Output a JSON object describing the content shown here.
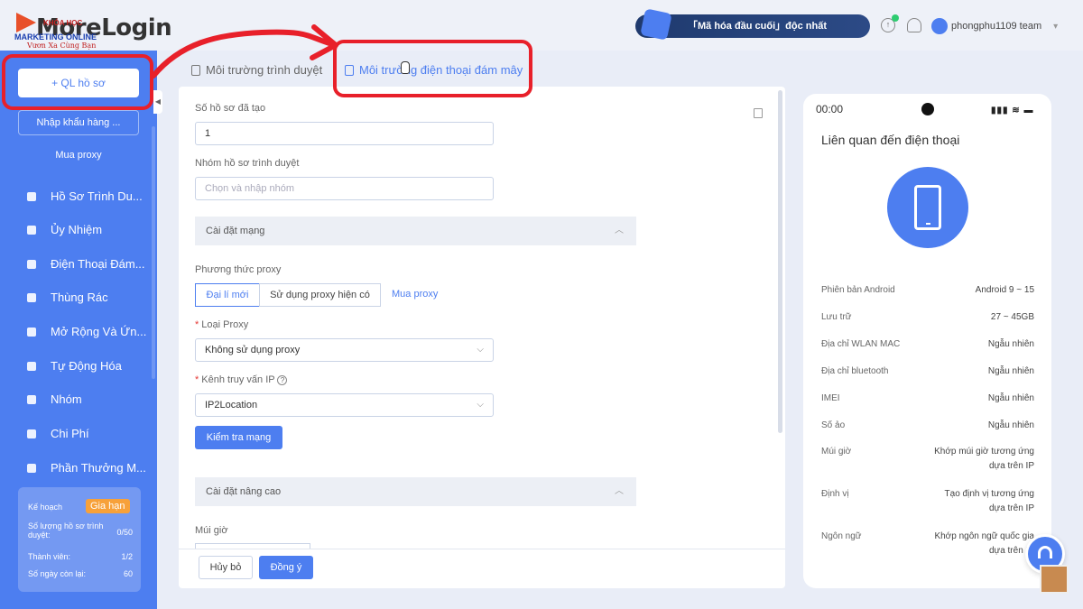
{
  "logo": {
    "brand": "MoreLogin",
    "overlay_top": "KHÓA HỌC",
    "overlay_mid": "MARKETING ONLINE",
    "overlay_bottom": "Vươn Xa Cùng Bạn"
  },
  "header": {
    "promo_text": "「Mã hóa đầu cuối」độc nhất",
    "user_name": "phongphu1109 team"
  },
  "sidebar": {
    "create_button": "+ QL hồ sơ",
    "import_button": "Nhập khẩu hàng ...",
    "buy_proxy": "Mua proxy",
    "items": [
      {
        "label": "Hồ Sơ Trình Du...",
        "icon": "browser-profile-icon"
      },
      {
        "label": "Ủy Nhiệm",
        "icon": "delegate-icon"
      },
      {
        "label": "Điện Thoại Đám...",
        "icon": "cloud-phone-icon"
      },
      {
        "label": "Thùng Rác",
        "icon": "trash-icon"
      },
      {
        "label": "Mở Rộng Và Ứn...",
        "icon": "extension-icon"
      },
      {
        "label": "Tự Động Hóa",
        "icon": "robot-icon"
      },
      {
        "label": "Nhóm",
        "icon": "group-icon"
      },
      {
        "label": "Chi Phí",
        "icon": "cost-icon"
      },
      {
        "label": "Phần Thưởng M...",
        "icon": "reward-icon"
      }
    ],
    "plan": {
      "label": "Kế hoạch",
      "renew": "Gia hạn",
      "profiles_label": "Số lượng hồ sơ trình duyệt:",
      "profiles_value": "0/50",
      "members_label": "Thành viên:",
      "members_value": "1/2",
      "days_label": "Số ngày còn lại:",
      "days_value": "60"
    }
  },
  "tabs": [
    {
      "label": "Môi trường trình duyệt"
    },
    {
      "label": "Môi trường điện thoại đám mây"
    }
  ],
  "form": {
    "count_label": "Số hồ sơ đã tạo",
    "count_value": "1",
    "group_label": "Nhóm hồ sơ trình duyệt",
    "group_placeholder": "Chọn và nhập nhóm",
    "network_section": "Cài đặt mạng",
    "proxy_method_label": "Phương thức proxy",
    "proxy_method_options": [
      "Đại lí mới",
      "Sử dụng proxy hiện có"
    ],
    "buy_proxy_link": "Mua proxy",
    "proxy_type_label": "Loại Proxy",
    "proxy_type_value": "Không sử dụng proxy",
    "ip_channel_label": "Kênh truy vấn IP",
    "ip_channel_value": "IP2Location",
    "check_network_button": "Kiểm tra mạng",
    "advanced_section": "Cài đặt nâng cao",
    "timezone_label": "Múi giờ",
    "cancel_button": "Hủy bỏ",
    "confirm_button": "Đồng ý"
  },
  "phone_preview": {
    "time": "00:00",
    "title": "Liên quan đến điện thoại",
    "specs": [
      {
        "label": "Phiên bản Android",
        "value": "Android 9 ~ 15"
      },
      {
        "label": "Lưu trữ",
        "value": "27 ~ 45GB"
      },
      {
        "label": "Địa chỉ WLAN MAC",
        "value": "Ngẫu nhiên"
      },
      {
        "label": "Địa chỉ bluetooth",
        "value": "Ngẫu nhiên"
      },
      {
        "label": "IMEI",
        "value": "Ngẫu nhiên"
      },
      {
        "label": "Số ảo",
        "value": "Ngẫu nhiên"
      },
      {
        "label": "Múi giờ",
        "value": "Khớp múi giờ tương ứng dựa trên IP"
      },
      {
        "label": "Định vị",
        "value": "Tạo định vị tương ứng dựa trên IP"
      },
      {
        "label": "Ngôn ngữ",
        "value": "Khớp ngôn ngữ quốc gia dựa trên IP"
      }
    ]
  },
  "colors": {
    "accent": "#4d7ef0",
    "annotation_red": "#e8202a",
    "renew_badge": "#f7a13a"
  }
}
